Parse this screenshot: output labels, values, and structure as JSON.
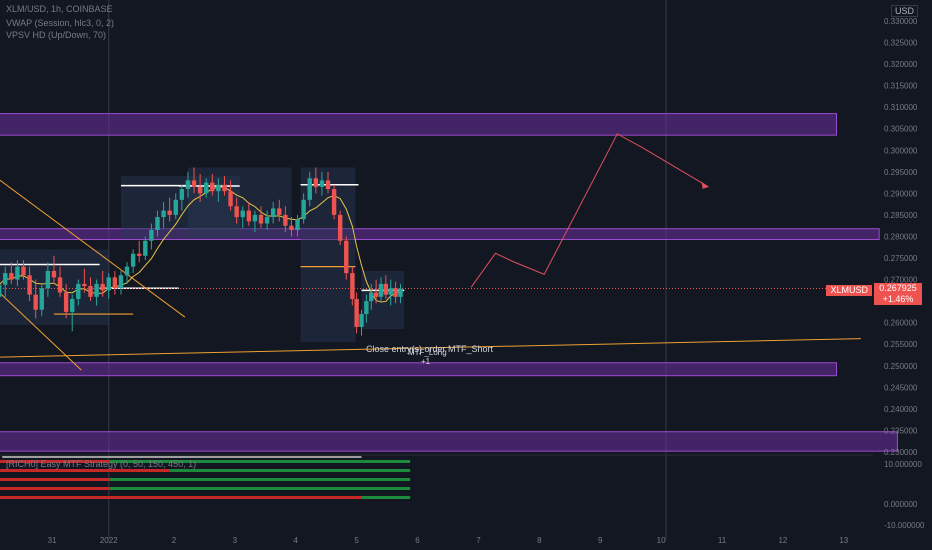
{
  "legend": {
    "symbol": "XLM/USD, 1h, COINBASE",
    "indicator_1": "VWAP (Session, hlc3, 0, 2)",
    "indicator_2": "VPSV HD (Up/Down, 70)",
    "strategy": "[RICH0] Easy MTF Strategy (0, 50, 150, 450, 1)"
  },
  "scale_label": "USD",
  "ticker": {
    "name": "XLMUSD",
    "price": "0.267925",
    "change": "+1.46%"
  },
  "annotations": {
    "order_label": "Close entry(s) order MTF_Short",
    "long_label": "MTF_Long",
    "long_qty": "+1"
  },
  "colors": {
    "background": "#131722",
    "up": "#26a69a",
    "down": "#ef5350",
    "zone": "#6a2fa0",
    "trend": "#f0a030",
    "projection": "#e04f5f"
  },
  "chart_data": {
    "type": "candlestick",
    "x_ticks": [
      "31",
      "2022",
      "2",
      "3",
      "4",
      "5",
      "6",
      "7",
      "8",
      "9",
      "10",
      "11",
      "12",
      "13"
    ],
    "y_ticks": [
      "0.330000",
      "0.325000",
      "0.320000",
      "0.315000",
      "0.310000",
      "0.305000",
      "0.300000",
      "0.295000",
      "0.290000",
      "0.285000",
      "0.280000",
      "0.275000",
      "0.270000",
      "0.265000",
      "0.260000",
      "0.255000",
      "0.250000",
      "0.245000",
      "0.240000",
      "0.235000",
      "0.230000"
    ],
    "ylim": [
      0.23,
      0.333
    ],
    "lower_y_ticks": [
      "10.000000",
      "0.000000",
      "-10.000000"
    ],
    "last_price": 0.267925,
    "zones": [
      {
        "low": 0.3035,
        "high": 0.3085,
        "x_start": -1,
        "x_end": 12.8
      },
      {
        "low": 0.2793,
        "high": 0.2818,
        "x_start": -1,
        "x_end": 13.5
      },
      {
        "low": 0.2477,
        "high": 0.2507,
        "x_start": -1,
        "x_end": 12.8
      },
      {
        "low": 0.2302,
        "high": 0.2347,
        "x_start": -1,
        "x_end": 13.8
      }
    ],
    "projection_path": [
      [
        6.8,
        0.2682
      ],
      [
        7.2,
        0.2761
      ],
      [
        7.5,
        0.2741
      ],
      [
        8.0,
        0.2712
      ],
      [
        9.2,
        0.3038
      ],
      [
        9.6,
        0.3007
      ],
      [
        10.7,
        0.2915
      ]
    ],
    "trend_line_up": [
      [
        -1,
        0.252
      ],
      [
        13.2,
        0.2563
      ]
    ],
    "trend_line_1": [
      [
        -1,
        0.2937
      ],
      [
        2.1,
        0.2613
      ]
    ],
    "trend_line_2": [
      [
        -1,
        0.2677
      ],
      [
        0.4,
        0.249
      ]
    ],
    "candles": [
      {
        "x": -0.95,
        "o": 0.266,
        "h": 0.27,
        "l": 0.2635,
        "c": 0.2688
      },
      {
        "x": -0.85,
        "o": 0.2688,
        "h": 0.273,
        "l": 0.266,
        "c": 0.2715
      },
      {
        "x": -0.75,
        "o": 0.2715,
        "h": 0.274,
        "l": 0.269,
        "c": 0.27
      },
      {
        "x": -0.65,
        "o": 0.27,
        "h": 0.2745,
        "l": 0.2685,
        "c": 0.273
      },
      {
        "x": -0.55,
        "o": 0.273,
        "h": 0.2745,
        "l": 0.27,
        "c": 0.271
      },
      {
        "x": -0.45,
        "o": 0.271,
        "h": 0.273,
        "l": 0.265,
        "c": 0.2665
      },
      {
        "x": -0.35,
        "o": 0.2665,
        "h": 0.27,
        "l": 0.261,
        "c": 0.263
      },
      {
        "x": -0.25,
        "o": 0.263,
        "h": 0.269,
        "l": 0.2615,
        "c": 0.268
      },
      {
        "x": -0.15,
        "o": 0.268,
        "h": 0.274,
        "l": 0.266,
        "c": 0.272
      },
      {
        "x": -0.05,
        "o": 0.272,
        "h": 0.2755,
        "l": 0.269,
        "c": 0.2705
      },
      {
        "x": 0.05,
        "o": 0.2705,
        "h": 0.273,
        "l": 0.266,
        "c": 0.267
      },
      {
        "x": 0.15,
        "o": 0.267,
        "h": 0.269,
        "l": 0.261,
        "c": 0.2625
      },
      {
        "x": 0.25,
        "o": 0.2625,
        "h": 0.2665,
        "l": 0.258,
        "c": 0.2655
      },
      {
        "x": 0.35,
        "o": 0.2655,
        "h": 0.27,
        "l": 0.264,
        "c": 0.269
      },
      {
        "x": 0.45,
        "o": 0.269,
        "h": 0.2725,
        "l": 0.267,
        "c": 0.2685
      },
      {
        "x": 0.55,
        "o": 0.2685,
        "h": 0.2705,
        "l": 0.265,
        "c": 0.266
      },
      {
        "x": 0.65,
        "o": 0.266,
        "h": 0.27,
        "l": 0.264,
        "c": 0.269
      },
      {
        "x": 0.75,
        "o": 0.269,
        "h": 0.272,
        "l": 0.266,
        "c": 0.2675
      },
      {
        "x": 0.85,
        "o": 0.2675,
        "h": 0.2715,
        "l": 0.2655,
        "c": 0.2705
      },
      {
        "x": 0.95,
        "o": 0.2705,
        "h": 0.272,
        "l": 0.2665,
        "c": 0.268
      },
      {
        "x": 1.05,
        "o": 0.268,
        "h": 0.272,
        "l": 0.2665,
        "c": 0.271
      },
      {
        "x": 1.15,
        "o": 0.271,
        "h": 0.274,
        "l": 0.269,
        "c": 0.273
      },
      {
        "x": 1.25,
        "o": 0.273,
        "h": 0.277,
        "l": 0.2715,
        "c": 0.276
      },
      {
        "x": 1.35,
        "o": 0.276,
        "h": 0.279,
        "l": 0.274,
        "c": 0.2755
      },
      {
        "x": 1.45,
        "o": 0.2755,
        "h": 0.28,
        "l": 0.2745,
        "c": 0.279
      },
      {
        "x": 1.55,
        "o": 0.279,
        "h": 0.283,
        "l": 0.277,
        "c": 0.2815
      },
      {
        "x": 1.65,
        "o": 0.2815,
        "h": 0.286,
        "l": 0.28,
        "c": 0.2845
      },
      {
        "x": 1.75,
        "o": 0.2845,
        "h": 0.288,
        "l": 0.282,
        "c": 0.286
      },
      {
        "x": 1.85,
        "o": 0.286,
        "h": 0.289,
        "l": 0.2835,
        "c": 0.285
      },
      {
        "x": 1.95,
        "o": 0.285,
        "h": 0.29,
        "l": 0.284,
        "c": 0.2885
      },
      {
        "x": 2.05,
        "o": 0.2885,
        "h": 0.292,
        "l": 0.286,
        "c": 0.291
      },
      {
        "x": 2.15,
        "o": 0.291,
        "h": 0.295,
        "l": 0.289,
        "c": 0.293
      },
      {
        "x": 2.25,
        "o": 0.293,
        "h": 0.296,
        "l": 0.29,
        "c": 0.2915
      },
      {
        "x": 2.35,
        "o": 0.2915,
        "h": 0.2945,
        "l": 0.288,
        "c": 0.29
      },
      {
        "x": 2.45,
        "o": 0.29,
        "h": 0.2935,
        "l": 0.289,
        "c": 0.2925
      },
      {
        "x": 2.55,
        "o": 0.2925,
        "h": 0.2945,
        "l": 0.2895,
        "c": 0.2905
      },
      {
        "x": 2.65,
        "o": 0.2905,
        "h": 0.2935,
        "l": 0.288,
        "c": 0.292
      },
      {
        "x": 2.75,
        "o": 0.292,
        "h": 0.294,
        "l": 0.2895,
        "c": 0.2905
      },
      {
        "x": 2.85,
        "o": 0.2905,
        "h": 0.293,
        "l": 0.286,
        "c": 0.287
      },
      {
        "x": 2.95,
        "o": 0.287,
        "h": 0.289,
        "l": 0.283,
        "c": 0.2845
      },
      {
        "x": 3.05,
        "o": 0.2845,
        "h": 0.287,
        "l": 0.282,
        "c": 0.286
      },
      {
        "x": 3.15,
        "o": 0.286,
        "h": 0.288,
        "l": 0.2825,
        "c": 0.2835
      },
      {
        "x": 3.25,
        "o": 0.2835,
        "h": 0.286,
        "l": 0.281,
        "c": 0.285
      },
      {
        "x": 3.35,
        "o": 0.285,
        "h": 0.287,
        "l": 0.282,
        "c": 0.283
      },
      {
        "x": 3.45,
        "o": 0.283,
        "h": 0.286,
        "l": 0.2815,
        "c": 0.2845
      },
      {
        "x": 3.55,
        "o": 0.2845,
        "h": 0.288,
        "l": 0.283,
        "c": 0.2865
      },
      {
        "x": 3.65,
        "o": 0.2865,
        "h": 0.2885,
        "l": 0.2835,
        "c": 0.285
      },
      {
        "x": 3.75,
        "o": 0.285,
        "h": 0.287,
        "l": 0.281,
        "c": 0.2825
      },
      {
        "x": 3.85,
        "o": 0.2825,
        "h": 0.2845,
        "l": 0.28,
        "c": 0.2815
      },
      {
        "x": 3.95,
        "o": 0.2815,
        "h": 0.285,
        "l": 0.28,
        "c": 0.284
      },
      {
        "x": 4.05,
        "o": 0.284,
        "h": 0.29,
        "l": 0.283,
        "c": 0.2885
      },
      {
        "x": 4.15,
        "o": 0.2885,
        "h": 0.295,
        "l": 0.287,
        "c": 0.2935
      },
      {
        "x": 4.25,
        "o": 0.2935,
        "h": 0.296,
        "l": 0.29,
        "c": 0.2915
      },
      {
        "x": 4.35,
        "o": 0.2915,
        "h": 0.295,
        "l": 0.2895,
        "c": 0.293
      },
      {
        "x": 4.45,
        "o": 0.293,
        "h": 0.295,
        "l": 0.29,
        "c": 0.291
      },
      {
        "x": 4.55,
        "o": 0.291,
        "h": 0.292,
        "l": 0.284,
        "c": 0.285
      },
      {
        "x": 4.65,
        "o": 0.285,
        "h": 0.286,
        "l": 0.278,
        "c": 0.279
      },
      {
        "x": 4.75,
        "o": 0.279,
        "h": 0.28,
        "l": 0.27,
        "c": 0.2715
      },
      {
        "x": 4.85,
        "o": 0.2715,
        "h": 0.273,
        "l": 0.264,
        "c": 0.2655
      },
      {
        "x": 4.92,
        "o": 0.2655,
        "h": 0.267,
        "l": 0.2575,
        "c": 0.259
      },
      {
        "x": 5.0,
        "o": 0.259,
        "h": 0.263,
        "l": 0.257,
        "c": 0.262
      },
      {
        "x": 5.08,
        "o": 0.262,
        "h": 0.2665,
        "l": 0.26,
        "c": 0.265
      },
      {
        "x": 5.16,
        "o": 0.265,
        "h": 0.269,
        "l": 0.263,
        "c": 0.267
      },
      {
        "x": 5.24,
        "o": 0.267,
        "h": 0.27,
        "l": 0.2645,
        "c": 0.266
      },
      {
        "x": 5.32,
        "o": 0.266,
        "h": 0.2705,
        "l": 0.265,
        "c": 0.269
      },
      {
        "x": 5.4,
        "o": 0.269,
        "h": 0.271,
        "l": 0.2655,
        "c": 0.2665
      },
      {
        "x": 5.48,
        "o": 0.2665,
        "h": 0.27,
        "l": 0.264,
        "c": 0.268
      },
      {
        "x": 5.56,
        "o": 0.268,
        "h": 0.2695,
        "l": 0.2645,
        "c": 0.266
      },
      {
        "x": 5.64,
        "o": 0.266,
        "h": 0.269,
        "l": 0.2645,
        "c": 0.2679
      }
    ]
  }
}
